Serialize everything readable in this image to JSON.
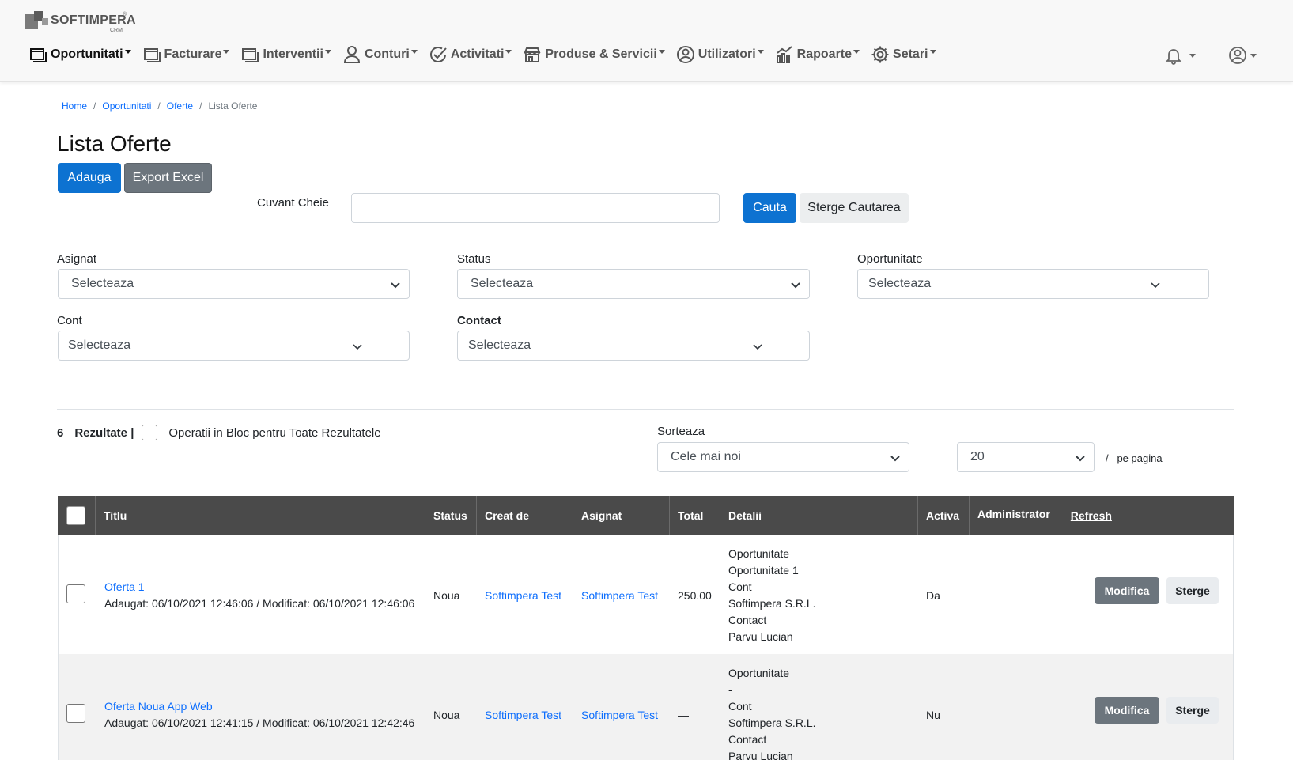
{
  "brand": {
    "name": "SOFTIMPERA",
    "sub": "CRM",
    "reg": "®"
  },
  "nav": [
    {
      "label": "Oportunitati",
      "icon": "window-icon",
      "active": true
    },
    {
      "label": "Facturare",
      "icon": "window-icon"
    },
    {
      "label": "Interventii",
      "icon": "window-icon"
    },
    {
      "label": "Conturi",
      "icon": "user-icon"
    },
    {
      "label": "Activitati",
      "icon": "check-circle-icon"
    },
    {
      "label": "Produse & Servicii",
      "icon": "shop-icon"
    },
    {
      "label": "Utilizatori",
      "icon": "user-circle-icon"
    },
    {
      "label": "Rapoarte",
      "icon": "chart-icon"
    },
    {
      "label": "Setari",
      "icon": "gear-icon"
    }
  ],
  "breadcrumb": {
    "home": "Home",
    "oportunitati": "Oportunitati",
    "oferte": "Oferte",
    "current": "Lista Oferte",
    "sep": "/"
  },
  "page_title": "Lista Oferte",
  "buttons": {
    "add": "Adauga",
    "export": "Export Excel",
    "search": "Cauta",
    "clear": "Sterge Cautarea"
  },
  "keyword": {
    "label": "Cuvant Cheie",
    "value": "",
    "placeholder": ""
  },
  "filters": {
    "asignat": {
      "label": "Asignat",
      "value": "Selecteaza"
    },
    "status": {
      "label": "Status",
      "value": "Selecteaza"
    },
    "oportunitate": {
      "label": "Oportunitate",
      "value": "Selecteaza"
    },
    "cont": {
      "label": "Cont",
      "value": "Selecteaza"
    },
    "contact": {
      "label": "Contact",
      "value": "Selecteaza"
    }
  },
  "results": {
    "count": "6",
    "label": "Rezultate |",
    "bulk": "Operatii in Bloc pentru Toate Rezultatele"
  },
  "sort": {
    "label": "Sorteaza",
    "value": "Cele mai noi"
  },
  "per_page": {
    "value": "20",
    "label": "/   pe pagina"
  },
  "table": {
    "headers": {
      "title": "Titlu",
      "status": "Status",
      "created_by": "Creat de",
      "assigned": "Asignat",
      "total": "Total",
      "details": "Detalii",
      "active": "Activa",
      "admin": "Administrator",
      "refresh": "Refresh"
    },
    "rows": [
      {
        "title": "Oferta 1",
        "meta": "Adaugat: 06/10/2021 12:46:06 / Modificat: 06/10/2021 12:46:06",
        "status": "Noua",
        "created_by": "Softimpera Test",
        "assigned": "Softimpera Test",
        "total": "250.00",
        "details": [
          "Oportunitate",
          "Oportunitate 1",
          "Cont",
          "Softimpera S.R.L.",
          "Contact",
          "Parvu Lucian"
        ],
        "active": "Da",
        "edit": "Modifica",
        "delete": "Sterge"
      },
      {
        "title": "Oferta Noua App Web",
        "meta": "Adaugat: 06/10/2021 12:41:15 / Modificat: 06/10/2021 12:42:46",
        "status": "Noua",
        "created_by": "Softimpera Test",
        "assigned": "Softimpera Test",
        "total": "—",
        "details": [
          "Oportunitate",
          "-",
          "Cont",
          "Softimpera S.R.L.",
          "Contact",
          "Parvu Lucian"
        ],
        "active": "Nu",
        "edit": "Modifica",
        "delete": "Sterge"
      }
    ]
  },
  "colors": {
    "primary": "#0d72d1",
    "link": "#0d6efd",
    "table_header": "#4a4a4a",
    "secondary": "#6c757d"
  }
}
